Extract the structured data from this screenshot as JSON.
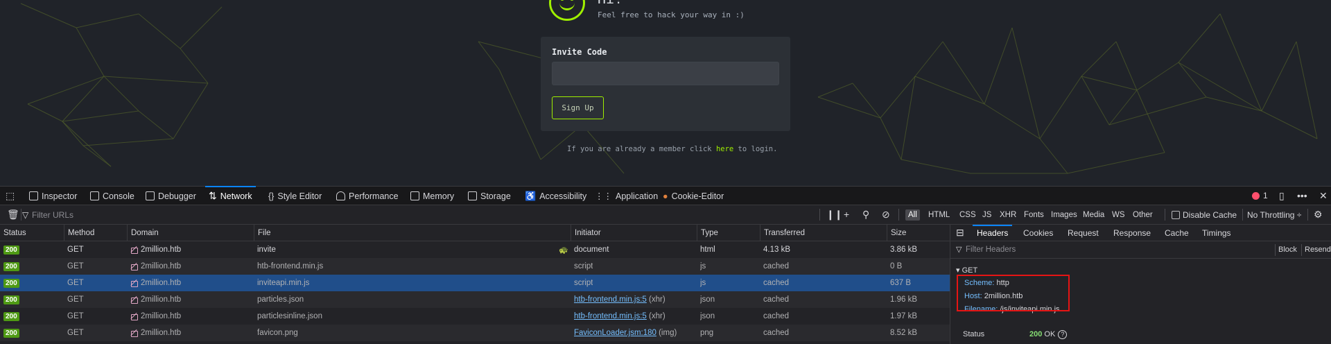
{
  "page": {
    "title": "Hi!",
    "subtitle": "Feel free to hack your way in :)",
    "invite_label": "Invite Code",
    "invite_value": "",
    "signup_label": "Sign Up",
    "login_prefix": "If you are already a member click ",
    "login_link": "here",
    "login_suffix": " to login.",
    "accent_color": "#9fef00"
  },
  "devtools": {
    "tabs": [
      {
        "label": "Inspector",
        "icon": "inspector-icon"
      },
      {
        "label": "Console",
        "icon": "console-icon"
      },
      {
        "label": "Debugger",
        "icon": "debugger-icon"
      },
      {
        "label": "Network",
        "icon": "network-icon",
        "active": true
      },
      {
        "label": "Style Editor",
        "icon": "style-editor-icon"
      },
      {
        "label": "Performance",
        "icon": "performance-icon"
      },
      {
        "label": "Memory",
        "icon": "memory-icon"
      },
      {
        "label": "Storage",
        "icon": "storage-icon"
      },
      {
        "label": "Accessibility",
        "icon": "accessibility-icon"
      },
      {
        "label": "Application",
        "icon": "application-icon"
      },
      {
        "label": "Cookie-Editor",
        "icon": "cookie-icon"
      }
    ],
    "error_count": "1",
    "toolbar": {
      "filter_placeholder": "Filter URLs",
      "types": [
        "All",
        "HTML",
        "CSS",
        "JS",
        "XHR",
        "Fonts",
        "Images",
        "Media",
        "WS",
        "Other"
      ],
      "active_type": "All",
      "disable_cache_label": "Disable Cache",
      "throttling_label": "No Throttling ÷"
    },
    "columns": [
      "Status",
      "Method",
      "Domain",
      "File",
      "Initiator",
      "Type",
      "Transferred",
      "Size"
    ],
    "requests": [
      {
        "status": "200",
        "method": "GET",
        "domain": "2million.htb",
        "file": "invite",
        "initiator": "document",
        "initiator_link": false,
        "type": "html",
        "transferred": "4.13 kB",
        "size": "3.86 kB"
      },
      {
        "status": "200",
        "method": "GET",
        "domain": "2million.htb",
        "file": "htb-frontend.min.js",
        "initiator": "script",
        "initiator_link": false,
        "type": "js",
        "transferred": "cached",
        "size": "0 B"
      },
      {
        "status": "200",
        "method": "GET",
        "domain": "2million.htb",
        "file": "inviteapi.min.js",
        "initiator": "script",
        "initiator_link": false,
        "type": "js",
        "transferred": "cached",
        "size": "637 B",
        "selected": true
      },
      {
        "status": "200",
        "method": "GET",
        "domain": "2million.htb",
        "file": "particles.json",
        "initiator": "htb-frontend.min.js:5",
        "initiator_suffix": " (xhr)",
        "initiator_link": true,
        "type": "json",
        "transferred": "cached",
        "size": "1.96 kB"
      },
      {
        "status": "200",
        "method": "GET",
        "domain": "2million.htb",
        "file": "particlesinline.json",
        "initiator": "htb-frontend.min.js:5",
        "initiator_suffix": " (xhr)",
        "initiator_link": true,
        "type": "json",
        "transferred": "cached",
        "size": "1.97 kB"
      },
      {
        "status": "200",
        "method": "GET",
        "domain": "2million.htb",
        "file": "favicon.png",
        "initiator": "FaviconLoader.jsm:180",
        "initiator_suffix": " (img)",
        "initiator_link": true,
        "type": "png",
        "transferred": "cached",
        "size": "8.52 kB"
      }
    ],
    "details": {
      "tabs": [
        "Headers",
        "Cookies",
        "Request",
        "Response",
        "Cache",
        "Timings"
      ],
      "active_tab": "Headers",
      "filter_placeholder": "Filter Headers",
      "block_label": "Block",
      "resend_label": "Resend",
      "method": "GET",
      "scheme_key": "Scheme:",
      "scheme_val": "http",
      "host_key": "Host:",
      "host_val": "2million.htb",
      "filename_key": "Filename:",
      "filename_val": "/js/inviteapi.min.js",
      "status_label": "Status",
      "status_code": "200",
      "status_text": "OK"
    }
  }
}
